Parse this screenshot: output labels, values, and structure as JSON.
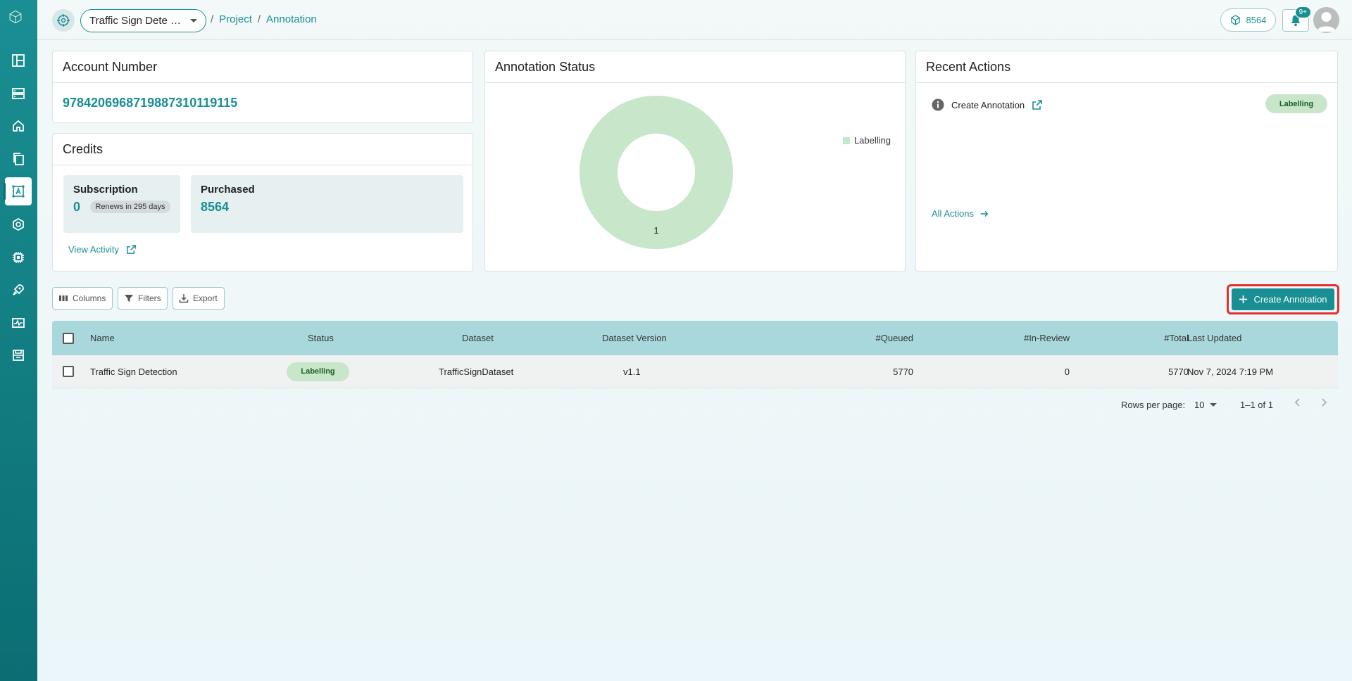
{
  "topbar": {
    "project_name": "Traffic Sign Dete …",
    "breadcrumb": [
      "Project",
      "Annotation"
    ],
    "credits": "8564",
    "notif_badge": "9+"
  },
  "account": {
    "title": "Account Number",
    "number": "9784206968719887310119115"
  },
  "credits": {
    "title": "Credits",
    "subscription_label": "Subscription",
    "subscription_value": "0",
    "renews": "Renews in 295 days",
    "purchased_label": "Purchased",
    "purchased_value": "8564",
    "view_activity": "View Activity"
  },
  "annotation_status": {
    "title": "Annotation Status",
    "legend": "Labelling",
    "label": "1"
  },
  "chart_data": {
    "type": "pie",
    "categories": [
      "Labelling"
    ],
    "values": [
      1
    ],
    "title": "Annotation Status",
    "colors": [
      "#c8e6c9"
    ]
  },
  "recent": {
    "title": "Recent Actions",
    "action": "Create Annotation",
    "status": "Labelling",
    "all_actions": "All Actions"
  },
  "toolbar": {
    "columns": "Columns",
    "filters": "Filters",
    "export": "Export",
    "create": "Create Annotation"
  },
  "table": {
    "headers": {
      "name": "Name",
      "status": "Status",
      "dataset": "Dataset",
      "version": "Dataset Version",
      "queued": "#Queued",
      "inreview": "#In-Review",
      "total": "#Total",
      "updated": "Last Updated"
    },
    "rows": [
      {
        "name": "Traffic Sign Detection",
        "status": "Labelling",
        "dataset": "TrafficSignDataset",
        "version": "v1.1",
        "queued": "5770",
        "inreview": "0",
        "total": "5770",
        "updated": "Nov 7, 2024 7:19 PM"
      }
    ]
  },
  "pagination": {
    "rows_label": "Rows per page:",
    "rows_value": "10",
    "range": "1–1 of 1"
  }
}
